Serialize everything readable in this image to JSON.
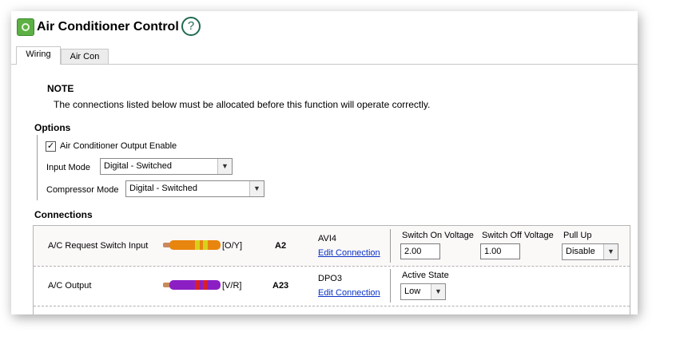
{
  "window": {
    "title": "Air Conditioner Control",
    "help_label": "?"
  },
  "tabs": [
    {
      "label": "Wiring",
      "active": true
    },
    {
      "label": "Air Con",
      "active": false
    }
  ],
  "note": {
    "title": "NOTE",
    "text": "The connections listed below must be allocated before this function will operate correctly."
  },
  "options": {
    "title": "Options",
    "output_enable": {
      "label": "Air Conditioner Output Enable",
      "checked": true,
      "mark": "✓"
    },
    "input_mode": {
      "label": "Input Mode",
      "value": "Digital - Switched"
    },
    "compressor_mode": {
      "label": "Compressor Mode",
      "value": "Digital - Switched"
    }
  },
  "connections": {
    "title": "Connections",
    "rows": [
      {
        "name": "A/C Request Switch Input",
        "wire_code": "[O/Y]",
        "wire_colors": {
          "base": "#e8850f",
          "stripe": "#d6d21a"
        },
        "pin": "A2",
        "channel": "AVI4",
        "edit_label": "Edit Connection",
        "fields": [
          {
            "label": "Switch On Voltage",
            "value": "2.00"
          },
          {
            "label": "Switch Off Voltage",
            "value": "1.00"
          }
        ],
        "pull_up": {
          "label": "Pull Up",
          "value": "Disable"
        }
      },
      {
        "name": "A/C Output",
        "wire_code": "[V/R]",
        "wire_colors": {
          "base": "#8c1fc4",
          "stripe": "#d81f2a"
        },
        "pin": "A23",
        "channel": "DPO3",
        "edit_label": "Edit Connection",
        "active_state": {
          "label": "Active State",
          "value": "Low"
        }
      }
    ]
  },
  "icons": {
    "dropdown": "▼"
  }
}
